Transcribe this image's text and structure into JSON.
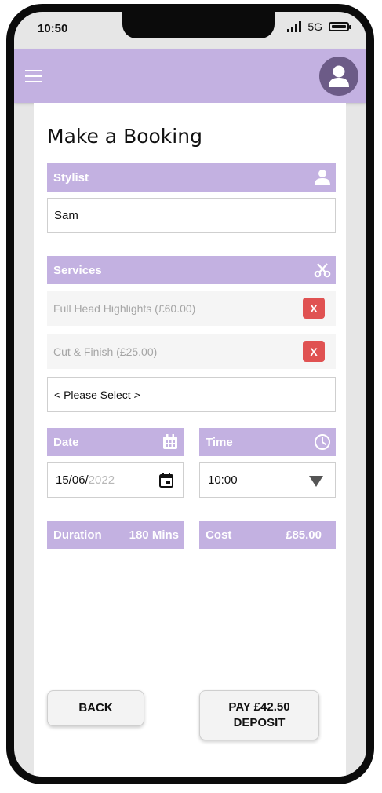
{
  "status_bar": {
    "time": "10:50",
    "network": "5G"
  },
  "header": {
    "menu_icon": "hamburger-menu-icon",
    "profile_icon": "user-avatar-icon"
  },
  "page": {
    "title": "Make a Booking"
  },
  "stylist": {
    "label": "Stylist",
    "icon": "person-icon",
    "value": "Sam"
  },
  "services": {
    "label": "Services",
    "icon": "scissors-icon",
    "items": [
      {
        "name": "Full Head Highlights (£60.00)",
        "remove_label": "X"
      },
      {
        "name": "Cut & Finish (£25.00)",
        "remove_label": "X"
      }
    ],
    "select_placeholder": "< Please Select >"
  },
  "date": {
    "label": "Date",
    "icon": "calendar-icon",
    "value_day_month": "15/06/",
    "value_year": "2022",
    "picker_icon": "calendar-event-icon"
  },
  "time": {
    "label": "Time",
    "icon": "clock-icon",
    "value": "10:00",
    "dropdown_icon": "triangle-down-icon"
  },
  "duration": {
    "label": "Duration",
    "value": "180 Mins"
  },
  "cost": {
    "label": "Cost",
    "value": "£85.00"
  },
  "actions": {
    "back_label": "BACK",
    "pay_label": "PAY £42.50\nDEPOSIT"
  },
  "colors": {
    "accent": "#c3b1e1",
    "avatar": "#6c5b87",
    "remove": "#e05252"
  }
}
